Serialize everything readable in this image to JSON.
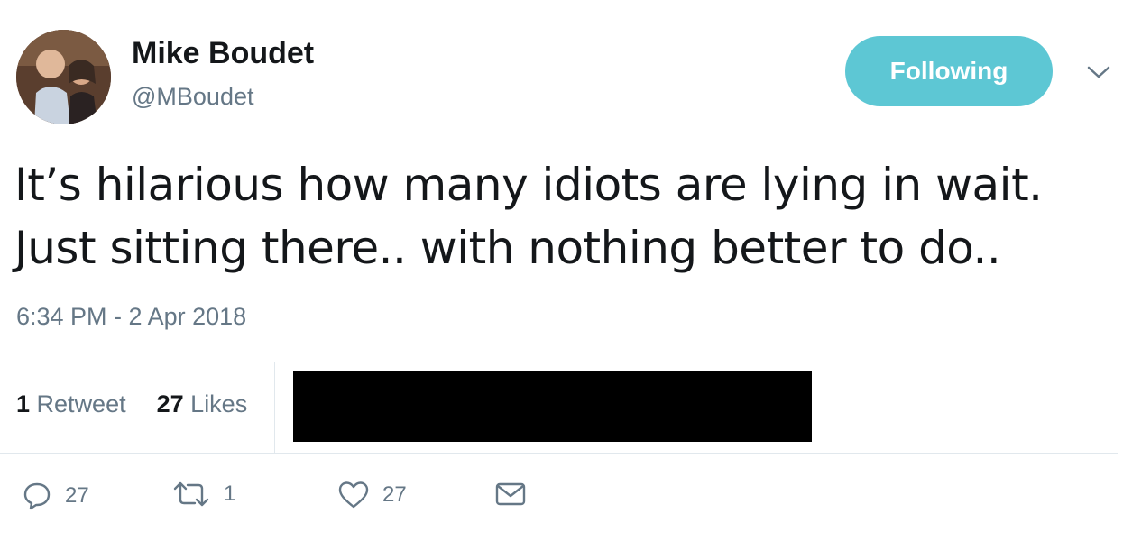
{
  "author": {
    "name": "Mike Boudet",
    "handle": "@MBoudet"
  },
  "follow_button": {
    "label": "Following"
  },
  "tweet": {
    "text_line1": "It’s hilarious how many idiots are lying in wait.",
    "text_line2": "Just sitting there.. with nothing better to do..",
    "timestamp": "6:34 PM - 2 Apr 2018"
  },
  "stats": {
    "retweets_count": "1",
    "retweets_label": "Retweet",
    "likes_count": "27",
    "likes_label": "Likes"
  },
  "actions": {
    "reply_count": "27",
    "retweet_count": "1",
    "like_count": "27"
  },
  "colors": {
    "accent": "#5dc7d4",
    "secondary_text": "#657786",
    "primary_text": "#14171a",
    "divider": "#e1e8ed"
  },
  "icons": [
    "caret-down-icon",
    "reply-icon",
    "retweet-icon",
    "like-icon",
    "message-icon"
  ]
}
